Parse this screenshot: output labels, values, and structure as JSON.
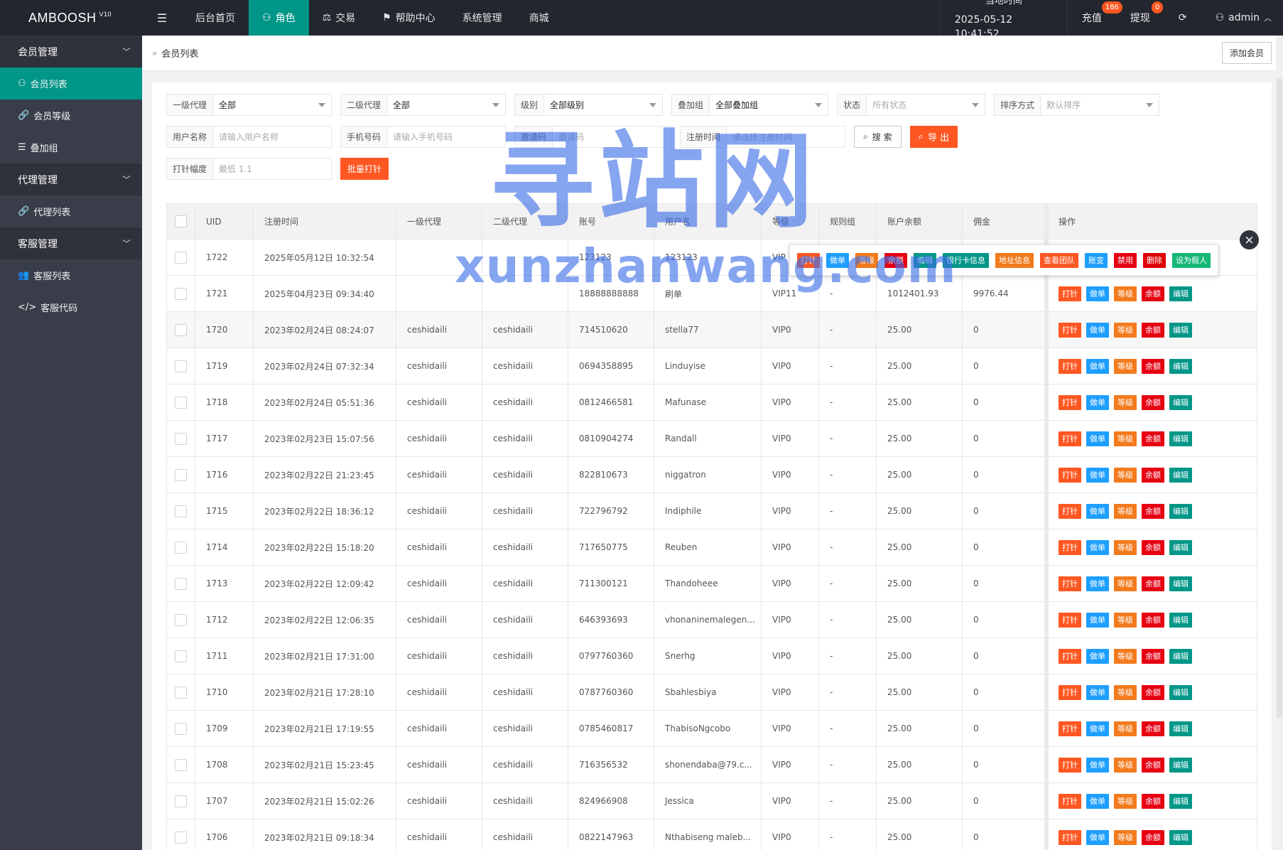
{
  "app": {
    "logo": "AMBOOSH",
    "version": "V10"
  },
  "topnav": {
    "toggle_icon": "menu-icon",
    "items": [
      {
        "label": "后台首页",
        "icon": ""
      },
      {
        "label": "角色",
        "icon": "user-icon",
        "active": true
      },
      {
        "label": "交易",
        "icon": "scale-icon"
      },
      {
        "label": "帮助中心",
        "icon": "flag-icon"
      },
      {
        "label": "系统管理",
        "icon": ""
      },
      {
        "label": "商城",
        "icon": ""
      }
    ]
  },
  "topright": {
    "time_label": "当地时间",
    "time_value": "2025-05-12 10:41:52",
    "recharge": {
      "label": "充值",
      "badge": "186"
    },
    "withdraw": {
      "label": "提现",
      "badge": "0"
    },
    "user": "admin"
  },
  "sidebar": {
    "groups": [
      {
        "label": "会员管理",
        "items": [
          {
            "label": "会员列表",
            "icon": "user-icon",
            "active": true
          },
          {
            "label": "会员等级",
            "icon": "link-icon"
          },
          {
            "label": "叠加组",
            "icon": "list-icon"
          }
        ]
      },
      {
        "label": "代理管理",
        "items": [
          {
            "label": "代理列表",
            "icon": "link-icon"
          }
        ]
      },
      {
        "label": "客服管理",
        "items": [
          {
            "label": "客服列表",
            "icon": "users-icon"
          },
          {
            "label": "客服代码",
            "icon": "code-icon"
          }
        ]
      }
    ]
  },
  "breadcrumb": {
    "current": "会员列表",
    "add_button": "添加会员"
  },
  "filters": {
    "agent1": {
      "label": "一级代理",
      "value": "全部"
    },
    "agent2": {
      "label": "二级代理",
      "value": "全部"
    },
    "level": {
      "label": "级别",
      "value": "全部级别"
    },
    "group": {
      "label": "叠加组",
      "value": "全部叠加组"
    },
    "status": {
      "label": "状态",
      "placeholder": "所有状态"
    },
    "sort": {
      "label": "排序方式",
      "placeholder": "默认排序"
    },
    "username": {
      "label": "用户名称",
      "placeholder": "请输入用户名称"
    },
    "phone": {
      "label": "手机号码",
      "placeholder": "请输入手机号码"
    },
    "invite": {
      "label": "邀请码",
      "placeholder": "邀请码"
    },
    "regtime": {
      "label": "注册时间",
      "placeholder": "请选择注册时间"
    },
    "search_button": "搜 索",
    "export_button": "导 出",
    "needle": {
      "label": "打针幅度",
      "placeholder": "最低 1.1"
    },
    "batch_button": "批量打针"
  },
  "table": {
    "headers": [
      "UID",
      "注册时间",
      "一级代理",
      "二级代理",
      "账号",
      "用户名",
      "等级",
      "规则组",
      "账户余额",
      "佣金",
      "操作"
    ],
    "row_ops": [
      "打针",
      "做单",
      "等级",
      "余额",
      "编辑"
    ],
    "popup_ops": [
      "打针",
      "做单",
      "等级",
      "余额",
      "编辑",
      "银行卡信息",
      "地址信息",
      "查看团队",
      "账变",
      "禁用",
      "删除",
      "设为假人"
    ],
    "rows": [
      {
        "uid": "1722",
        "time": "2025年05月12日 10:32:54",
        "a1": "",
        "a2": "",
        "acct": "123123",
        "name": "123123",
        "lvl": "VIP",
        "rule": "",
        "bal": "",
        "comm": ""
      },
      {
        "uid": "1721",
        "time": "2025年04月23日 09:34:40",
        "a1": "",
        "a2": "",
        "acct": "18888888888",
        "name": "刷单",
        "lvl": "VIP11",
        "rule": "-",
        "bal": "1012401.93",
        "comm": "9976.44"
      },
      {
        "uid": "1720",
        "time": "2023年02月24日 08:24:07",
        "a1": "ceshidaili",
        "a2": "ceshidaili",
        "acct": "714510620",
        "name": "stella77",
        "lvl": "VIP0",
        "rule": "-",
        "bal": "25.00",
        "comm": "0"
      },
      {
        "uid": "1719",
        "time": "2023年02月24日 07:32:34",
        "a1": "ceshidaili",
        "a2": "ceshidaili",
        "acct": "0694358895",
        "name": "Linduyise",
        "lvl": "VIP0",
        "rule": "-",
        "bal": "25.00",
        "comm": "0"
      },
      {
        "uid": "1718",
        "time": "2023年02月24日 05:51:36",
        "a1": "ceshidaili",
        "a2": "ceshidaili",
        "acct": "0812466581",
        "name": "Mafunase",
        "lvl": "VIP0",
        "rule": "-",
        "bal": "25.00",
        "comm": "0"
      },
      {
        "uid": "1717",
        "time": "2023年02月23日 15:07:56",
        "a1": "ceshidaili",
        "a2": "ceshidaili",
        "acct": "0810904274",
        "name": "Randall",
        "lvl": "VIP0",
        "rule": "-",
        "bal": "25.00",
        "comm": "0"
      },
      {
        "uid": "1716",
        "time": "2023年02月22日 21:23:45",
        "a1": "ceshidaili",
        "a2": "ceshidaili",
        "acct": "822810673",
        "name": "niggatron",
        "lvl": "VIP0",
        "rule": "-",
        "bal": "25.00",
        "comm": "0"
      },
      {
        "uid": "1715",
        "time": "2023年02月22日 18:36:12",
        "a1": "ceshidaili",
        "a2": "ceshidaili",
        "acct": "722796792",
        "name": "Indiphile",
        "lvl": "VIP0",
        "rule": "-",
        "bal": "25.00",
        "comm": "0"
      },
      {
        "uid": "1714",
        "time": "2023年02月22日 15:18:20",
        "a1": "ceshidaili",
        "a2": "ceshidaili",
        "acct": "717650775",
        "name": "Reuben",
        "lvl": "VIP0",
        "rule": "-",
        "bal": "25.00",
        "comm": "0"
      },
      {
        "uid": "1713",
        "time": "2023年02月22日 12:09:42",
        "a1": "ceshidaili",
        "a2": "ceshidaili",
        "acct": "711300121",
        "name": "Thandoheee",
        "lvl": "VIP0",
        "rule": "-",
        "bal": "25.00",
        "comm": "0"
      },
      {
        "uid": "1712",
        "time": "2023年02月22日 12:06:35",
        "a1": "ceshidaili",
        "a2": "ceshidaili",
        "acct": "646393693",
        "name": "vhonaninemalegen...",
        "lvl": "VIP0",
        "rule": "-",
        "bal": "25.00",
        "comm": "0"
      },
      {
        "uid": "1711",
        "time": "2023年02月21日 17:31:00",
        "a1": "ceshidaili",
        "a2": "ceshidaili",
        "acct": "0797760360",
        "name": "Snerhg",
        "lvl": "VIP0",
        "rule": "-",
        "bal": "25.00",
        "comm": "0"
      },
      {
        "uid": "1710",
        "time": "2023年02月21日 17:28:10",
        "a1": "ceshidaili",
        "a2": "ceshidaili",
        "acct": "0787760360",
        "name": "Sbahlesbiya",
        "lvl": "VIP0",
        "rule": "-",
        "bal": "25.00",
        "comm": "0"
      },
      {
        "uid": "1709",
        "time": "2023年02月21日 17:19:55",
        "a1": "ceshidaili",
        "a2": "ceshidaili",
        "acct": "0785460817",
        "name": "ThabisoNgcobo",
        "lvl": "VIP0",
        "rule": "-",
        "bal": "25.00",
        "comm": "0"
      },
      {
        "uid": "1708",
        "time": "2023年02月21日 15:23:45",
        "a1": "ceshidaili",
        "a2": "ceshidaili",
        "acct": "716356532",
        "name": "shonendaba@79.c...",
        "lvl": "VIP0",
        "rule": "-",
        "bal": "25.00",
        "comm": "0"
      },
      {
        "uid": "1707",
        "time": "2023年02月21日 15:02:26",
        "a1": "ceshidaili",
        "a2": "ceshidaili",
        "acct": "824966908",
        "name": "Jessica",
        "lvl": "VIP0",
        "rule": "-",
        "bal": "25.00",
        "comm": "0"
      },
      {
        "uid": "1706",
        "time": "2023年02月21日 09:18:34",
        "a1": "ceshidaili",
        "a2": "ceshidaili",
        "acct": "0822147963",
        "name": "Nthabiseng maleb...",
        "lvl": "VIP0",
        "rule": "-",
        "bal": "25.00",
        "comm": "0"
      }
    ]
  },
  "watermark": {
    "cn": "寻站网",
    "en": "xunzhanwang.com"
  },
  "colors": {
    "accent": "#009688",
    "topbar": "#23262e",
    "sidebar": "#393d49",
    "danger": "#ff5722"
  }
}
